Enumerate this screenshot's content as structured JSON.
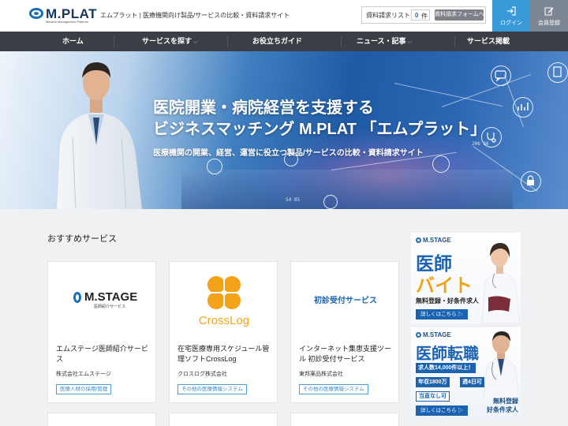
{
  "header": {
    "logo_text": "M.PLAT",
    "logo_sub": "Medical Management Platform",
    "tagline": "エムプラット | 医療機関向け製品/サービスの比較・資料請求サイト",
    "request_list_label": "資料請求リスト",
    "request_count": "0",
    "request_count_unit": "件",
    "request_form_button": "資料請求フォームへ",
    "login_label": "ログイン",
    "signup_label": "会員登録"
  },
  "nav": {
    "items": [
      {
        "label": "ホーム"
      },
      {
        "label": "サービスを探す"
      },
      {
        "label": "お役立ちガイド"
      },
      {
        "label": "ニュース・記事"
      },
      {
        "label": "サービス掲載"
      }
    ]
  },
  "hero": {
    "title_line1": "医院開業・病院経営を支援する",
    "title_line2": "ビジネスマッチング M.PLAT 「エムプラット」",
    "subtitle": "医療機関の開業、経営、運営に役立つ製品/サービスの比較・資料請求サイト",
    "num1": "206 36",
    "num2": "54 85"
  },
  "section": {
    "title": "おすすめサービス"
  },
  "cards": [
    {
      "logo_text": "M.STAGE",
      "logo_sub": "医師紹介サービス",
      "name": "エムステージ医師紹介サービス",
      "company": "株式会社エムステージ",
      "tag": "医療人材の採用/管理"
    },
    {
      "logo_text": "CrossLog",
      "name": "在宅医療専用スケジュール管理ソフトCrossLog",
      "company": "クロスログ株式会社",
      "tag": "その他の医療情報システム"
    },
    {
      "logo_text": "初診受付サービス",
      "name": "インターネット集患支援ツール 初診受付サービス",
      "company": "東邦薬品株式会社",
      "tag": "その他の医療情報システム"
    }
  ],
  "ads": [
    {
      "brand": "M.STAGE",
      "line1": "医師",
      "line2": "バイト",
      "text": "無料登録・好条件求人",
      "cta": "詳しくはこちら ▷"
    },
    {
      "brand": "M.STAGE",
      "line1": "医師転職",
      "badge1": "求人数14,000件以上！",
      "badge2": "年収1800万",
      "badge3": "週4日可",
      "badge4": "当直なし可",
      "free1": "無料登録",
      "free2": "好条件求人",
      "cta": "詳しくはこちら ▷"
    }
  ],
  "colors": {
    "brand_blue": "#1b62b0",
    "nav_bg": "#3b3f45",
    "login_bg": "#3a9ad9",
    "signup_bg": "#7d8793",
    "accent_orange": "#f2a31a"
  }
}
